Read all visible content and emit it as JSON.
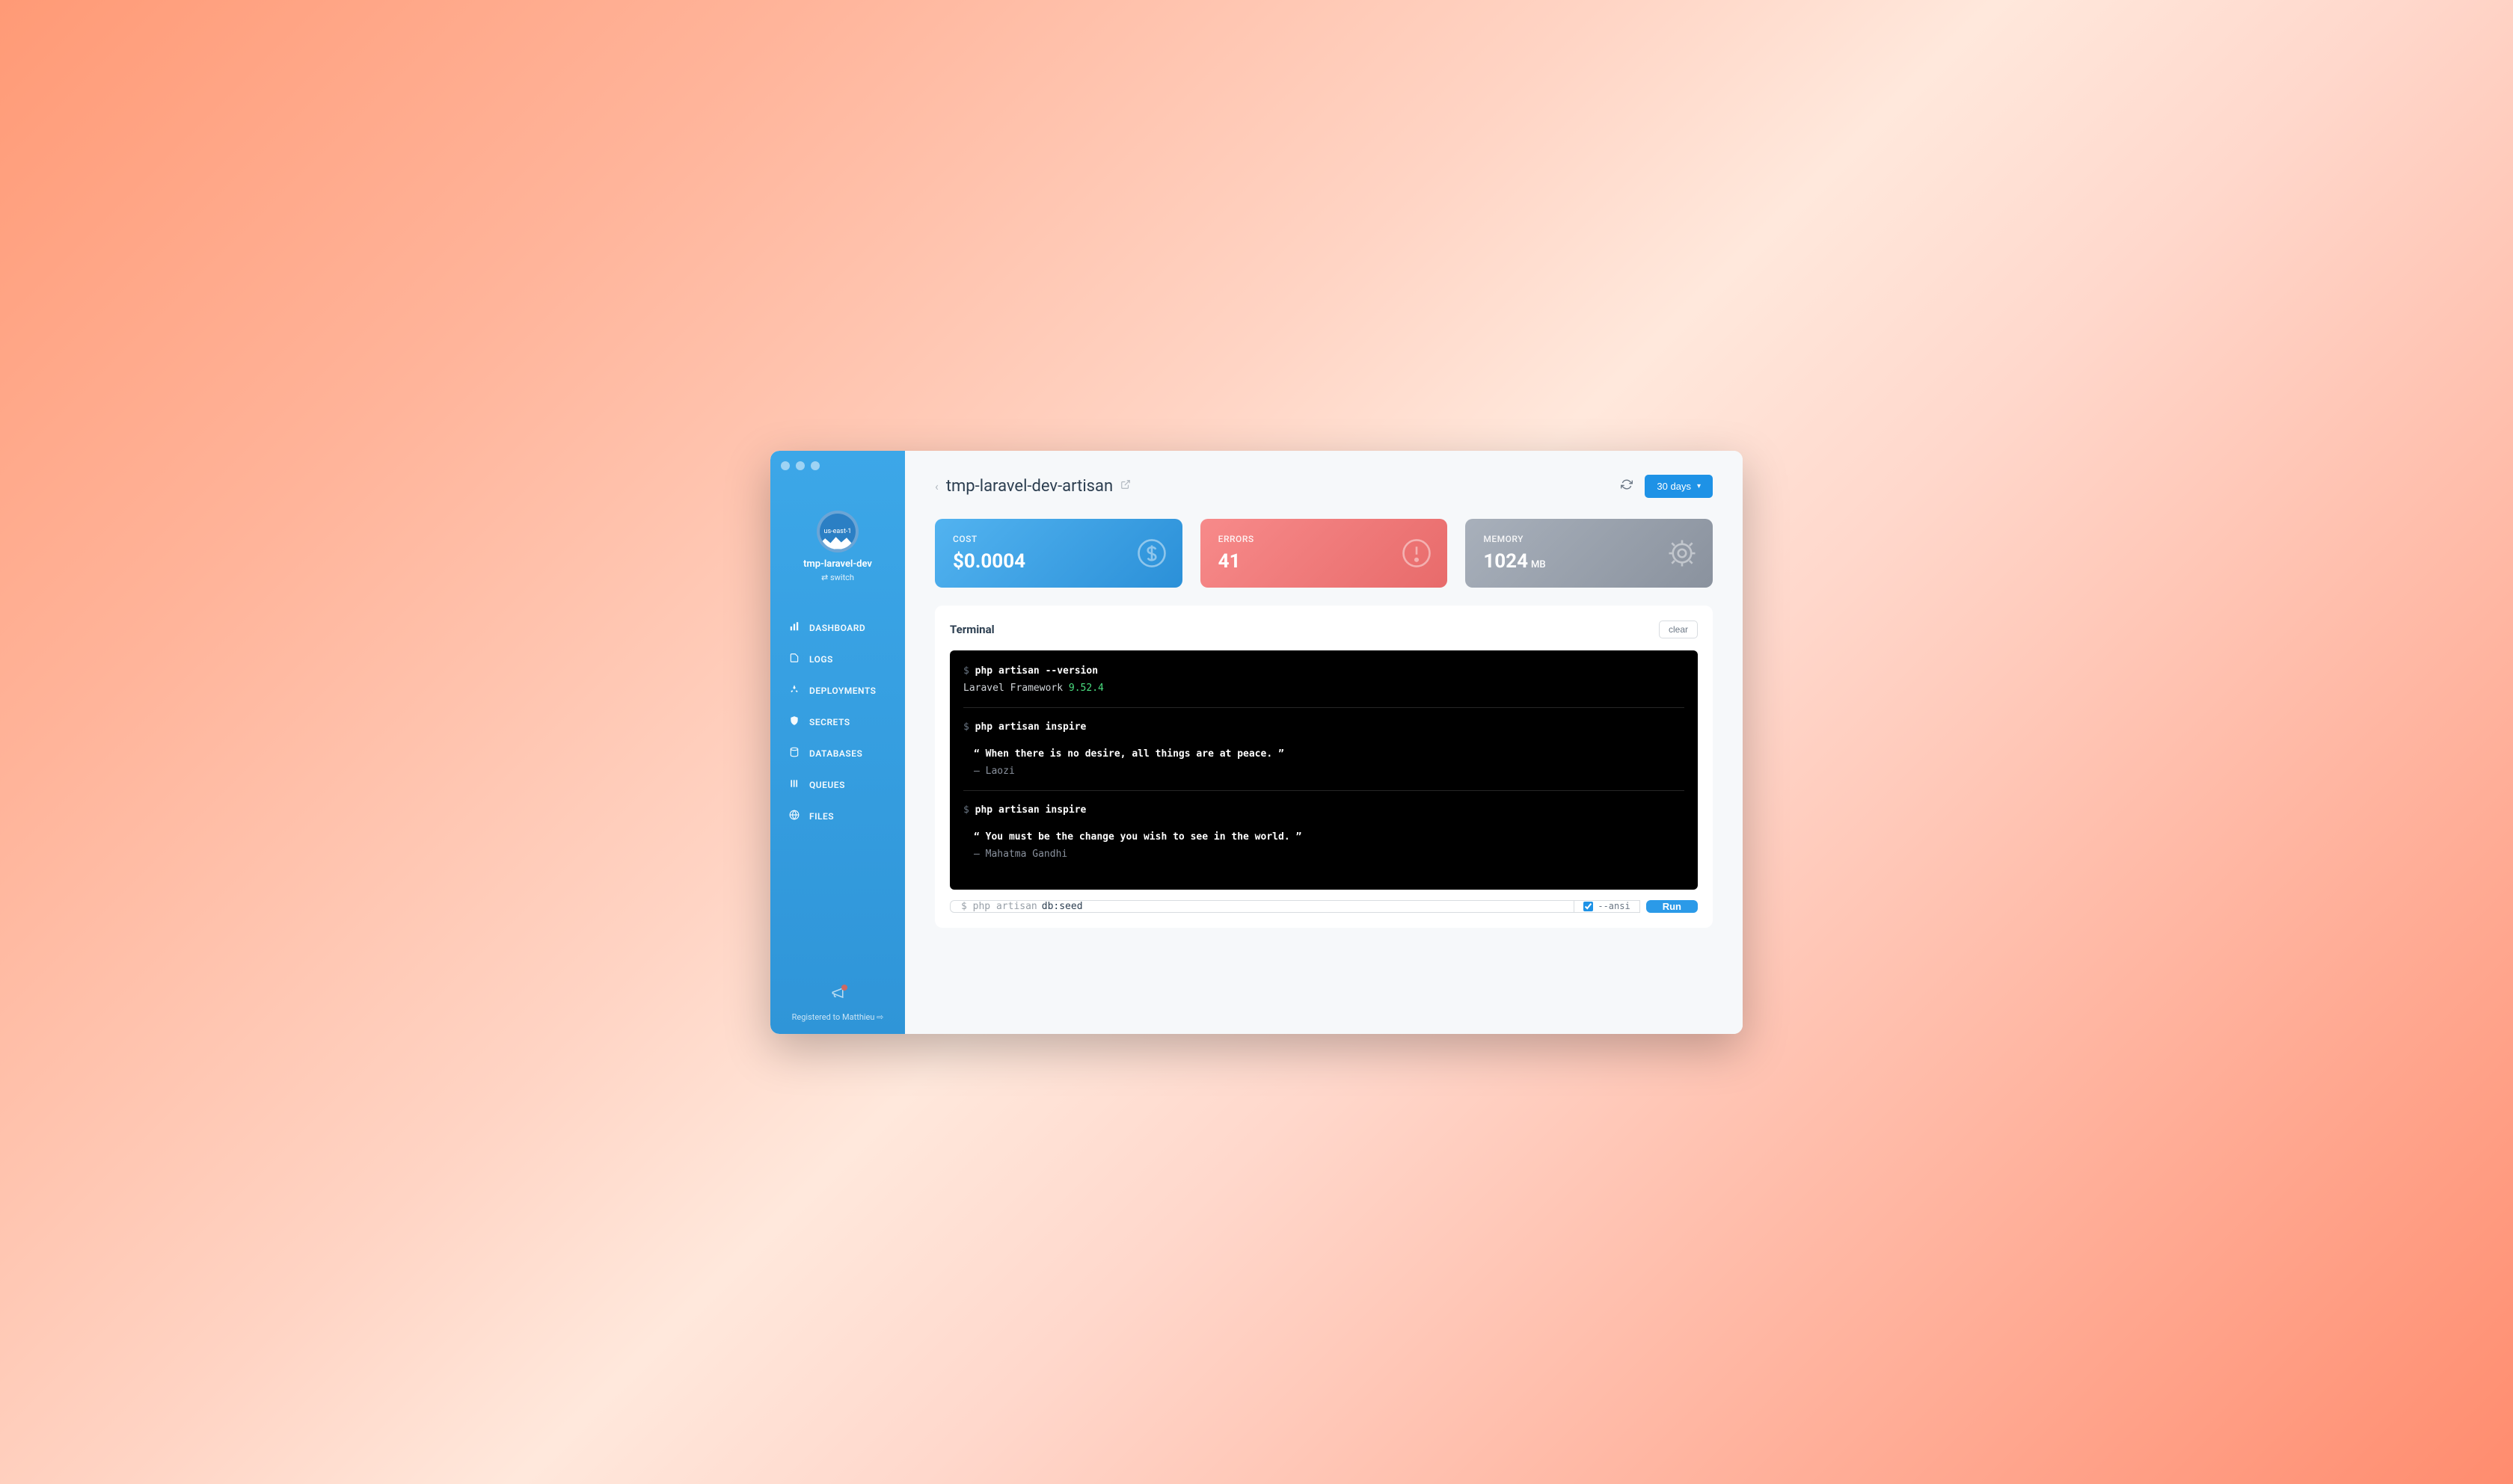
{
  "sidebar": {
    "region": "us-east-1",
    "project": "tmp-laravel-dev",
    "switch_label": "switch",
    "nav": [
      {
        "label": "DASHBOARD",
        "icon": "bar-chart"
      },
      {
        "label": "LOGS",
        "icon": "scroll"
      },
      {
        "label": "DEPLOYMENTS",
        "icon": "rocket"
      },
      {
        "label": "SECRETS",
        "icon": "shield"
      },
      {
        "label": "DATABASES",
        "icon": "database"
      },
      {
        "label": "QUEUES",
        "icon": "bars"
      },
      {
        "label": "FILES",
        "icon": "globe"
      }
    ],
    "footer": "Registered to Matthieu ⇨"
  },
  "header": {
    "title": "tmp-laravel-dev-artisan",
    "period": "30 days"
  },
  "cards": {
    "cost": {
      "label": "COST",
      "value": "$0.0004"
    },
    "errors": {
      "label": "ERRORS",
      "value": "41"
    },
    "memory": {
      "label": "MEMORY",
      "value": "1024",
      "unit": "MB"
    }
  },
  "terminal": {
    "title": "Terminal",
    "clear": "clear",
    "blocks": [
      {
        "cmd": "php artisan --version",
        "out_pre": "Laravel Framework ",
        "out_ver": "9.52.4"
      },
      {
        "cmd": "php artisan inspire",
        "quote": "“ When there is no desire, all things are at peace. ”",
        "author": "— Laozi"
      },
      {
        "cmd": "php artisan inspire",
        "quote": "“ You must be the change you wish to see in the world. ”",
        "author": "— Mahatma Gandhi"
      }
    ],
    "input_prefix": "$ php artisan",
    "input_value": "db:seed",
    "ansi_label": "--ansi",
    "ansi_checked": true,
    "run": "Run"
  }
}
